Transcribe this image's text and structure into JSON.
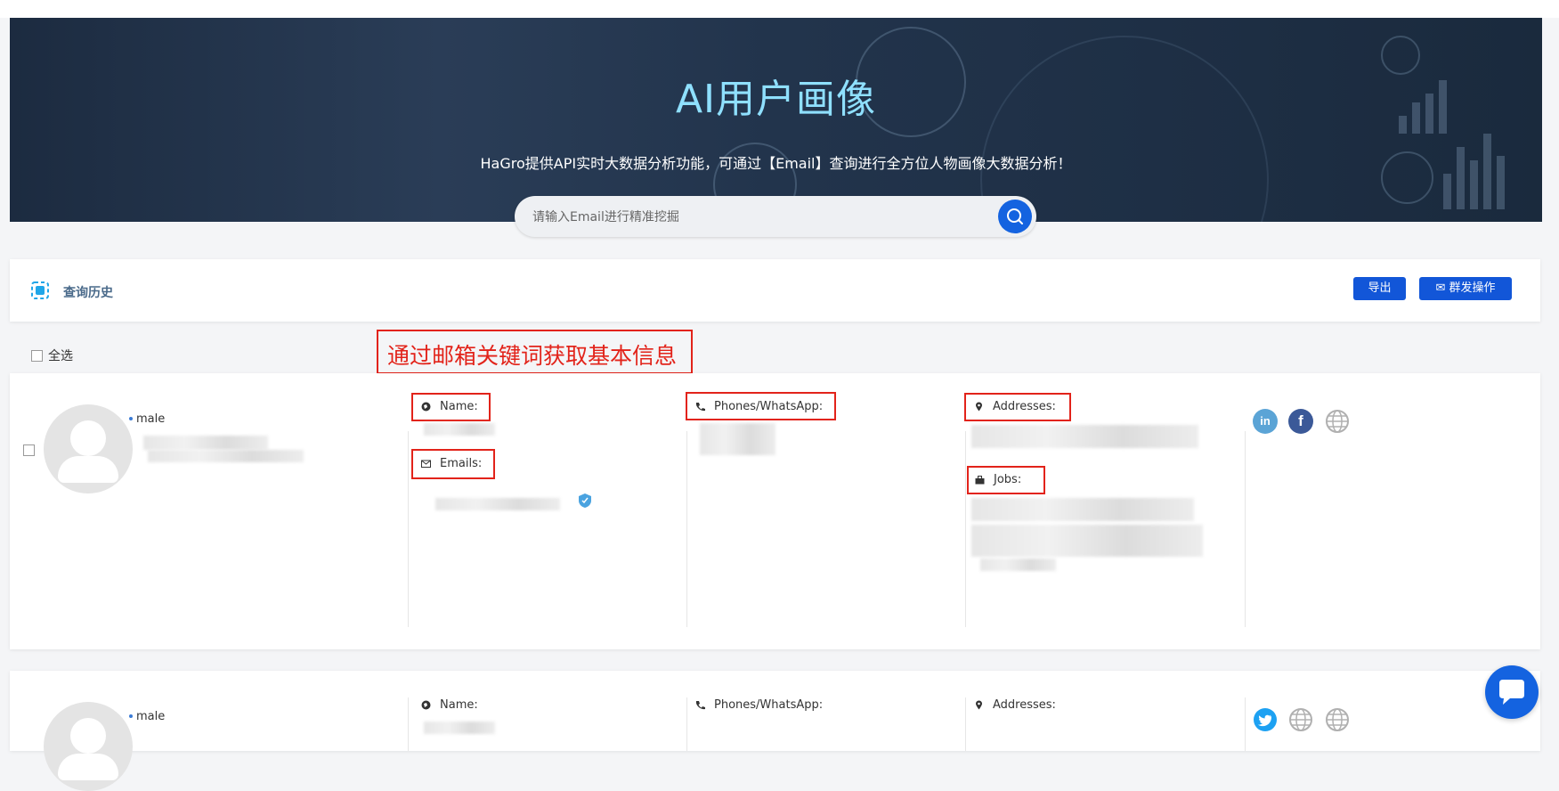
{
  "hero": {
    "title": "AI用户画像",
    "subtitle": "HaGro提供API实时大数据分析功能，可通过【Email】查询进行全方位人物画像大数据分析！",
    "search_placeholder": "请输入Email进行精准挖掘"
  },
  "history": {
    "label": "查询历史",
    "export_label": "导出",
    "bulk_label": "群发操作"
  },
  "select_all_label": "全选",
  "annotation_text": "通过邮箱关键词获取基本信息",
  "results": [
    {
      "gender": "male",
      "name_label": "Name:",
      "emails_label": "Emails:",
      "phones_label": "Phones/WhatsApp:",
      "addresses_label": "Addresses:",
      "jobs_label": "Jobs:",
      "socials": [
        "linkedin-icon",
        "facebook-icon",
        "web-icon"
      ]
    },
    {
      "gender": "male",
      "name_label": "Name:",
      "phones_label": "Phones/WhatsApp:",
      "addresses_label": "Addresses:",
      "socials": [
        "twitter-icon",
        "web-icon",
        "web-icon"
      ]
    }
  ],
  "colors": {
    "accent": "#1463e0",
    "annotation": "#e2231a",
    "title": "#8fe0ff"
  }
}
